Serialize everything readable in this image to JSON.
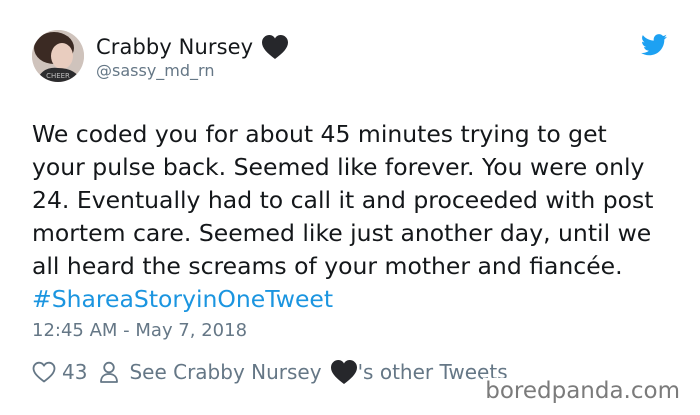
{
  "author": {
    "display_name": "Crabby Nursey",
    "handle": "@sassy_md_rn",
    "avatar_text": "CHEER"
  },
  "tweet": {
    "lines": [
      "We coded you for about 45 minutes trying to get",
      "your pulse back. Seemed like forever. You were only",
      "24. Eventually had to call it and proceeded with post",
      "mortem care. Seemed like just another day, until we",
      "all heard the screams of your mother and fiancée."
    ],
    "hashtag": "#ShareaStoryinOneTweet",
    "timestamp": "12:45 AM - May 7, 2018"
  },
  "footer": {
    "like_count": "43",
    "see_prefix": "See Crabby Nursey",
    "see_suffix": "'s other Tweets"
  },
  "icons": {
    "name_emoji": "black-heart-icon",
    "brand": "twitter-bird-icon",
    "like": "heart-outline-icon",
    "profile": "person-outline-icon"
  },
  "colors": {
    "text": "#14171a",
    "secondary": "#657786",
    "link": "#1b95e0",
    "twitter_blue": "#1da1f2"
  },
  "watermark": "boredpanda.com"
}
